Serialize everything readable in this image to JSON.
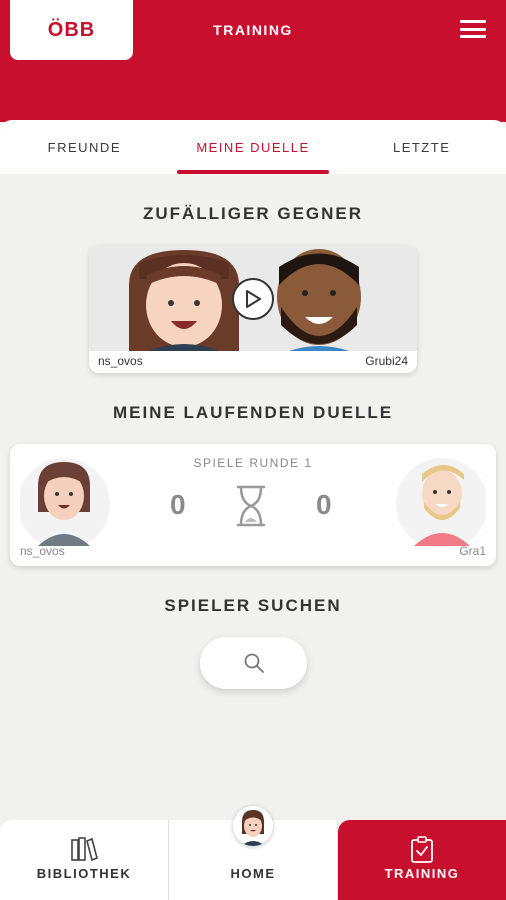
{
  "header": {
    "logo": "ÖBB",
    "title": "TRAINING",
    "menu_icon": "hamburger-menu-icon"
  },
  "tabs": [
    {
      "label": "FREUNDE",
      "active": false
    },
    {
      "label": "MEINE DUELLE",
      "active": true
    },
    {
      "label": "LETZTE",
      "active": false
    }
  ],
  "random_opponent": {
    "title": "ZUFÄLLIGER GEGNER",
    "player_left": "ns_ovos",
    "player_right": "Grubi24",
    "play_icon": "play-icon"
  },
  "running_duels": {
    "title": "MEINE LAUFENDEN DUELLE",
    "round_label": "SPIELE RUNDE 1",
    "score_left": "0",
    "score_right": "0",
    "player_left": "ns_ovos",
    "player_right": "Gra1",
    "status_icon": "hourglass-icon"
  },
  "search": {
    "title": "SPIELER SUCHEN",
    "icon": "search-icon"
  },
  "bottom_nav": [
    {
      "label": "BIBLIOTHEK",
      "icon": "books-icon",
      "active": false
    },
    {
      "label": "HOME",
      "icon": "avatar",
      "active": false
    },
    {
      "label": "TRAINING",
      "icon": "clipboard-check-icon",
      "active": true
    }
  ],
  "colors": {
    "brand_red": "#c8102e",
    "background": "#f1f1ee"
  }
}
